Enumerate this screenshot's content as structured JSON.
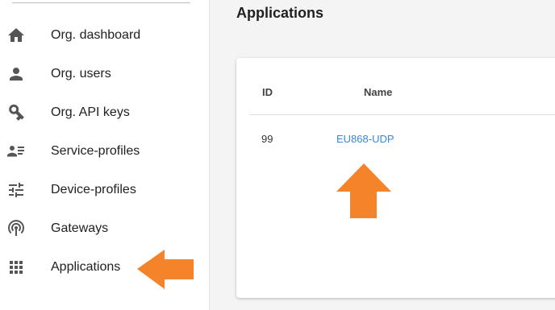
{
  "sidebar": {
    "items": [
      {
        "label": "Org. dashboard",
        "icon": "home-icon"
      },
      {
        "label": "Org. users",
        "icon": "person-icon"
      },
      {
        "label": "Org. API keys",
        "icon": "key-icon"
      },
      {
        "label": "Service-profiles",
        "icon": "account-details-icon"
      },
      {
        "label": "Device-profiles",
        "icon": "tune-icon"
      },
      {
        "label": "Gateways",
        "icon": "access-point-icon"
      },
      {
        "label": "Applications",
        "icon": "apps-icon"
      }
    ]
  },
  "main": {
    "title": "Applications",
    "table": {
      "columns": [
        "ID",
        "Name"
      ],
      "rows": [
        {
          "id": "99",
          "name": "EU868-UDP"
        }
      ]
    }
  },
  "colors": {
    "accent_orange": "#f5832a",
    "link_blue": "#3a87d6",
    "icon_gray": "#555555",
    "main_bg": "#f4f4f4"
  }
}
